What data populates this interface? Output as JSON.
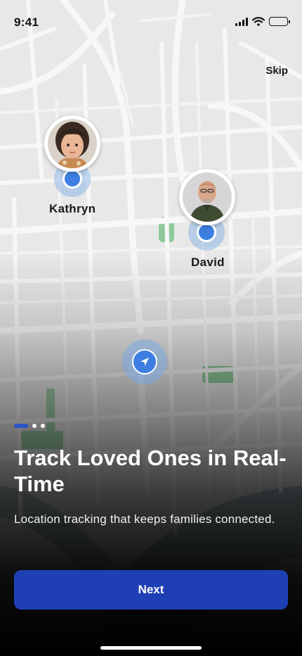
{
  "status_bar": {
    "time": "9:41"
  },
  "header": {
    "skip_label": "Skip"
  },
  "map": {
    "markers": [
      {
        "name": "Kathryn"
      },
      {
        "name": "David"
      }
    ]
  },
  "onboarding": {
    "current_page": 1,
    "page_count": 3,
    "title": "Track Loved Ones in Real-Time",
    "subtitle": "Location tracking that keeps families connected."
  },
  "actions": {
    "next_label": "Next"
  },
  "colors": {
    "primary_button": "#1f40b4",
    "pin_blue": "#3d7fe0",
    "park_green": "#8ec99a",
    "water_teal": "#6f97a0"
  },
  "icons": [
    "cellular-signal-icon",
    "wifi-icon",
    "battery-icon",
    "location-pin-icon",
    "navigation-arrow-icon"
  ]
}
